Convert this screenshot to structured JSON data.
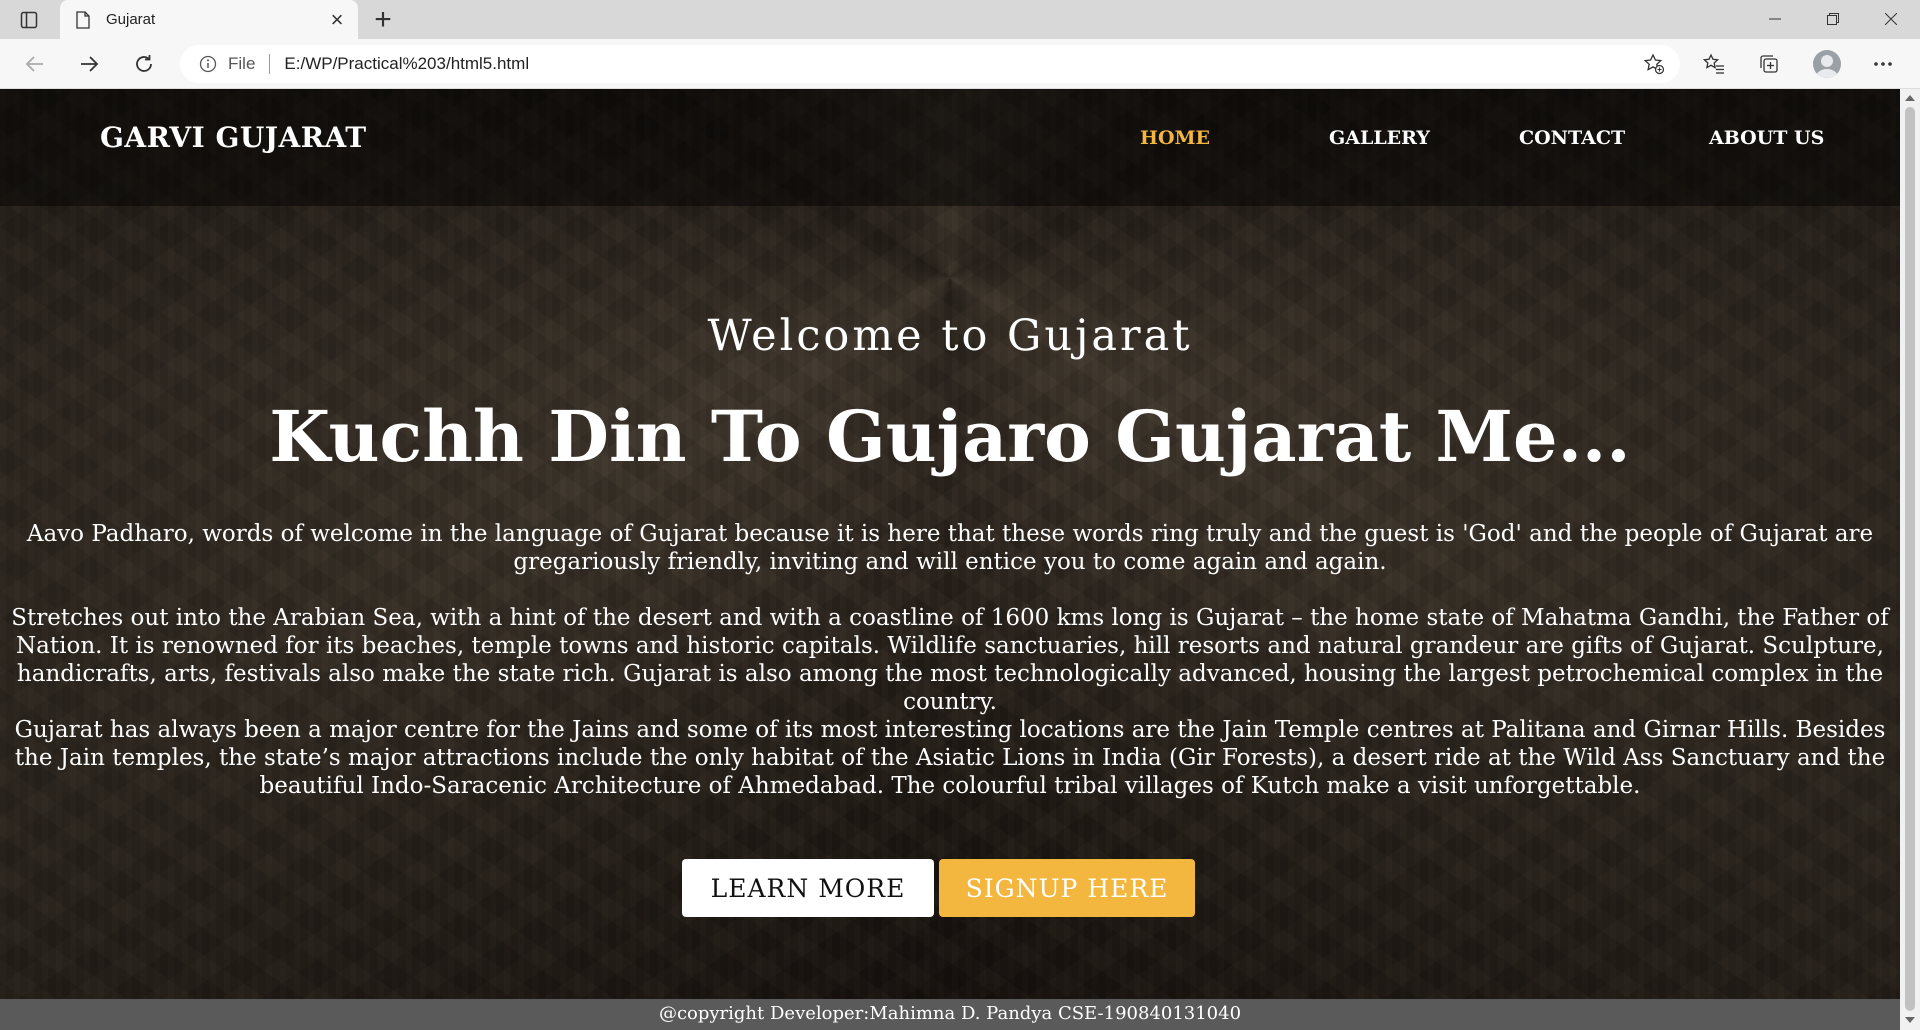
{
  "browser": {
    "tab_title": "Gujarat",
    "url_scheme": "File",
    "url": "E:/WP/Practical%203/html5.html"
  },
  "site": {
    "logo": "GARVI GUJARAT",
    "nav": {
      "home": "HOME",
      "gallery": "GALLERY",
      "contact": "CONTACT",
      "about": "ABOUT US"
    },
    "active_nav": "HOME",
    "accent_color": "#f3b63f"
  },
  "hero": {
    "subtitle": "Welcome to Gujarat",
    "title": "Kuchh Din To Gujaro Gujarat Me...",
    "paragraphs": [
      "Aavo Padharo, words of welcome in the language of Gujarat because it is here that these words ring truly and the guest is 'God' and the people of Gujarat are gregariously friendly, inviting and will entice you to come again and again.",
      "Stretches out into the Arabian Sea, with a hint of the desert and with a coastline of 1600 kms long is Gujarat – the home state of Mahatma Gandhi, the Father of Nation. It is renowned for its beaches, temple towns and historic capitals. Wildlife sanctuaries, hill resorts and natural grandeur are gifts of Gujarat. Sculpture, handicrafts, arts, festivals also make the state rich. Gujarat is also among the most technologically advanced, housing the largest petrochemical complex in the country.",
      "Gujarat has always been a major centre for the Jains and some of its most interesting locations are the Jain Temple centres at Palitana and Girnar Hills. Besides the Jain temples, the state’s major attractions include the only habitat of the Asiatic Lions in India (Gir Forests), a desert ride at the Wild Ass Sanctuary and the beautiful Indo-Saracenic Architecture of Ahmedabad. The colourful tribal villages of Kutch make a visit unforgettable."
    ],
    "learn_more": "LEARN MORE",
    "signup": "SIGNUP HERE"
  },
  "footer": {
    "copyright": "@copyright Developer:Mahimna D. Pandya CSE-190840131040"
  }
}
